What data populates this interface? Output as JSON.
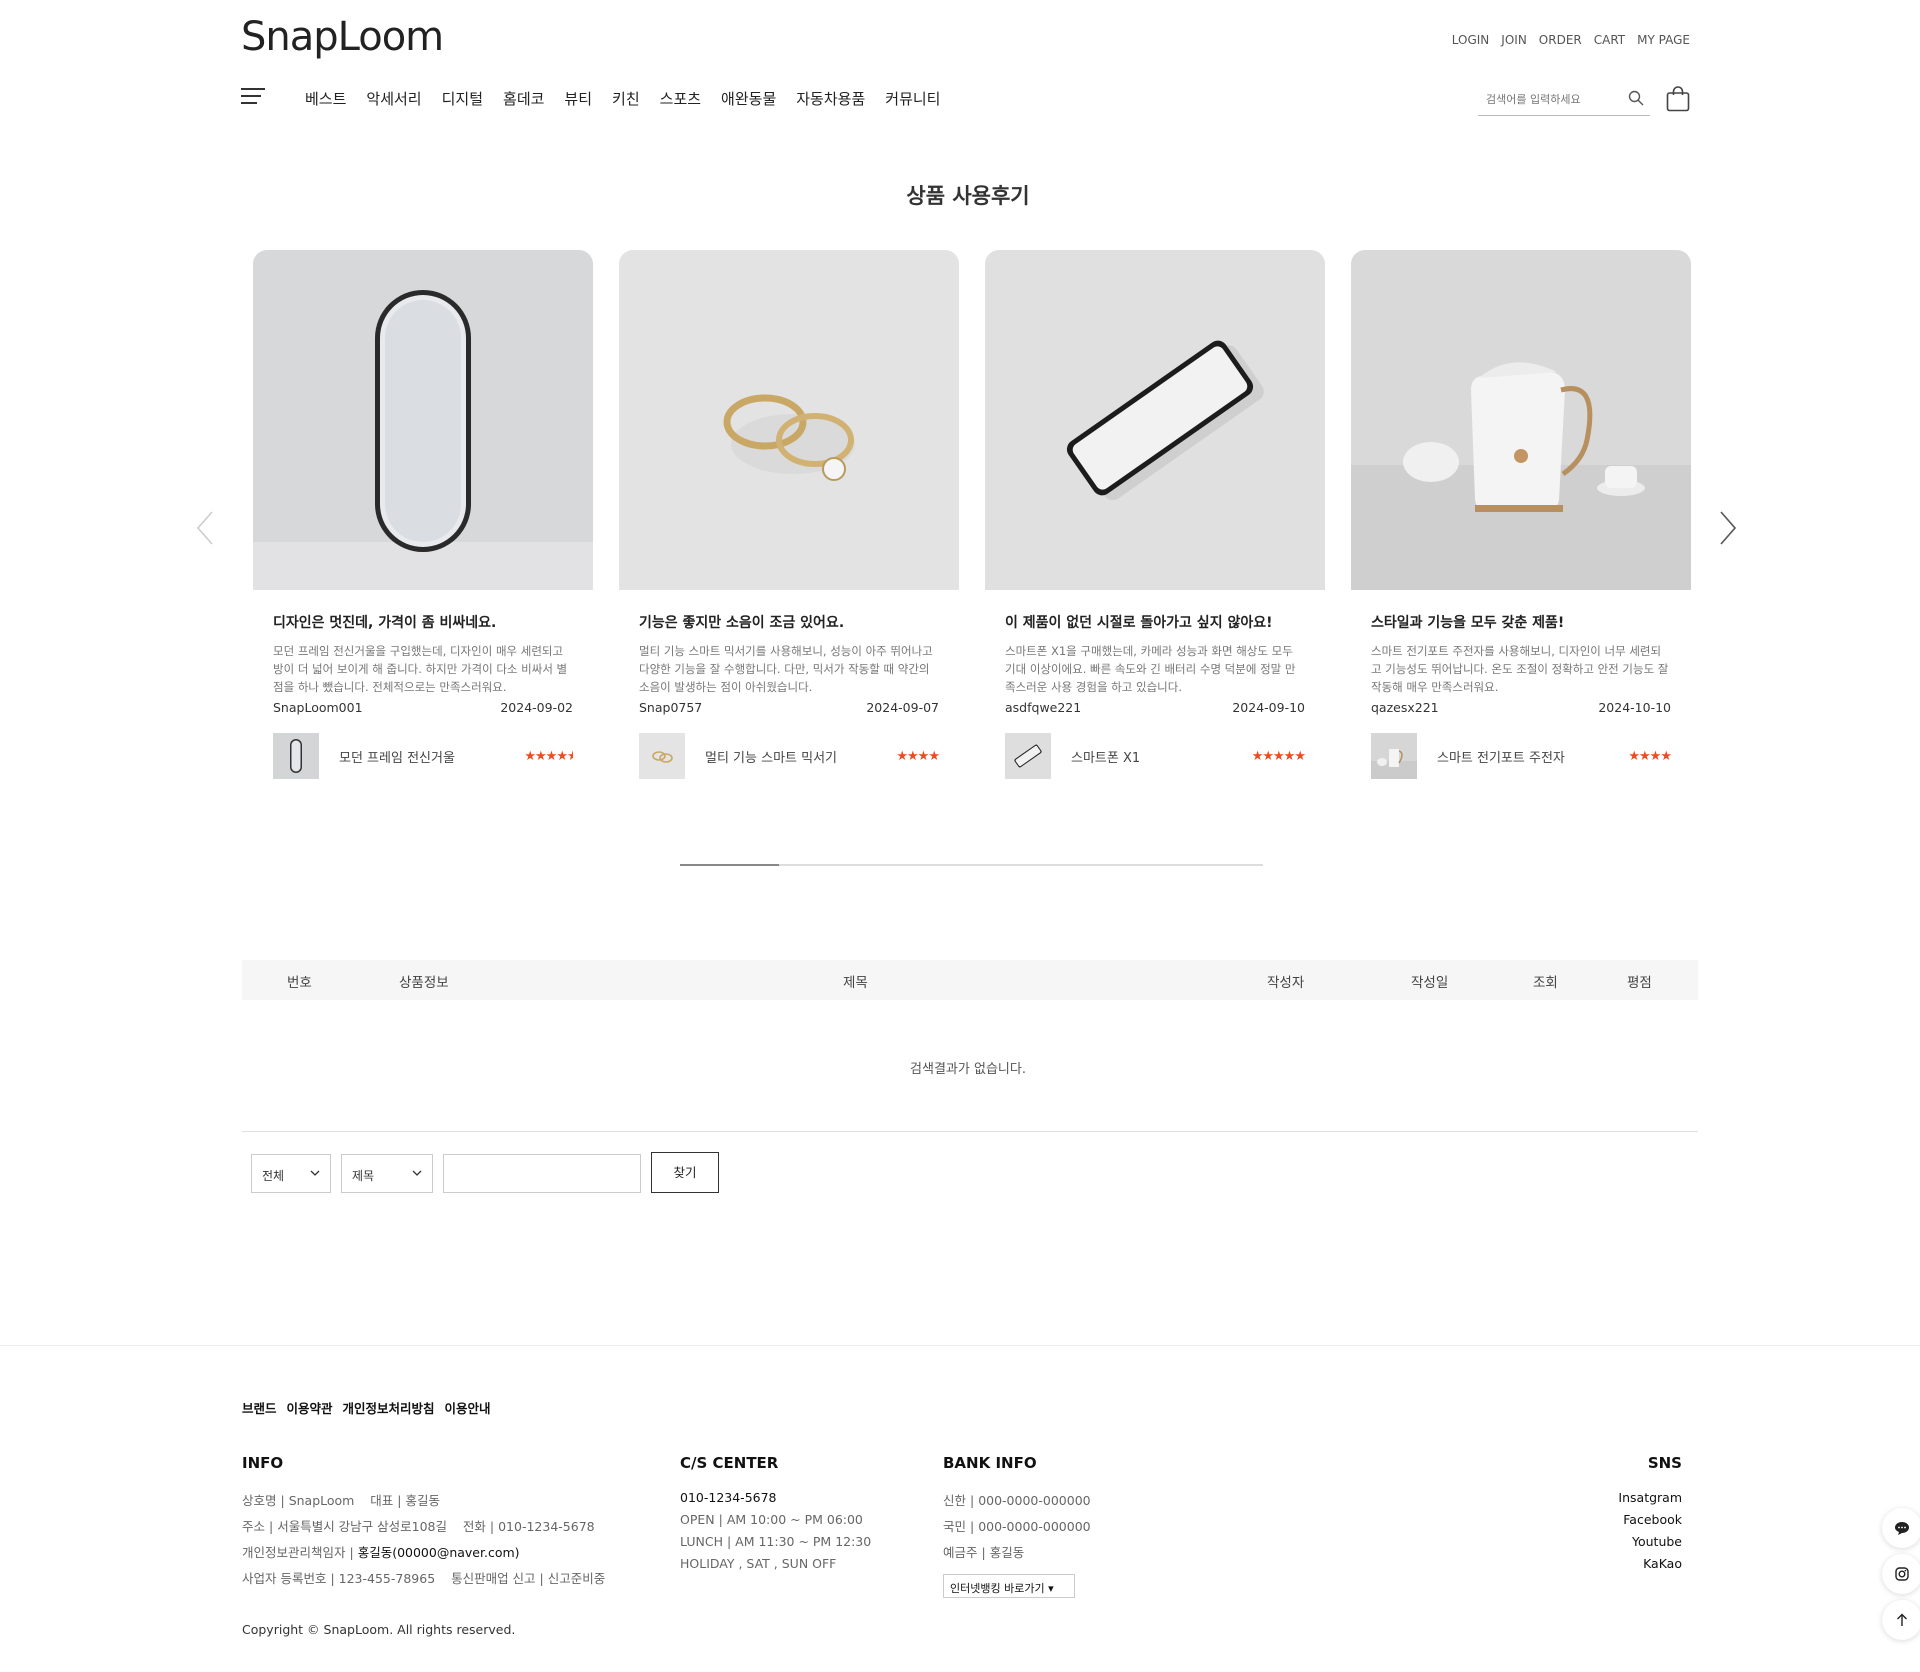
{
  "header": {
    "logo": "SnapLoom",
    "top_links": [
      "LOGIN",
      "JOIN",
      "ORDER",
      "CART",
      "MY PAGE"
    ],
    "nav": [
      "베스트",
      "악세서리",
      "디지털",
      "홈데코",
      "뷰티",
      "키친",
      "스포츠",
      "애완동물",
      "자동차용품",
      "커뮤니티"
    ],
    "search_placeholder": "검색어를 입력하세요"
  },
  "title": "상품 사용후기",
  "reviews": [
    {
      "title": "디자인은 멋진데, 가격이 좀 비싸네요.",
      "text": "모던 프레임 전신거울을 구입했는데, 디자인이 매우 세련되고 방이 더 넓어 보이게 해 줍니다. 하지만 가격이 다소 비싸서 별점을 하나 뺐습니다. 전체적으로는 만족스러워요.",
      "author": "SnapLoom001",
      "date": "2024-09-02",
      "product": "모던 프레임 전신거울",
      "rating": 4.5,
      "stars": "★★★★"
    },
    {
      "title": "기능은 좋지만 소음이 조금 있어요.",
      "text": "멀티 기능 스마트 믹서기를 사용해보니, 성능이 아주 뛰어나고 다양한 기능을 잘 수행합니다. 다만, 믹서가 작동할 때 약간의 소음이 발생하는 점이 아쉬웠습니다.",
      "author": "Snap0757",
      "date": "2024-09-07",
      "product": "멀티 기능 스마트 믹서기",
      "rating": 4,
      "stars": "★★★★"
    },
    {
      "title": "이 제품이 없던 시절로 돌아가고 싶지 않아요!",
      "text": "스마트폰 X1을 구매했는데, 카메라 성능과 화면 해상도 모두 기대 이상이에요. 빠른 속도와 긴 배터리 수명 덕분에 정말 만족스러운 사용 경험을 하고 있습니다.",
      "author": "asdfqwe221",
      "date": "2024-09-10",
      "product": "스마트폰 X1",
      "rating": 5,
      "stars": "★★★★★"
    },
    {
      "title": "스타일과 기능을 모두 갖춘 제품!",
      "text": "스마트 전기포트 주전자를 사용해보니, 디자인이 너무 세련되고 기능성도 뛰어납니다. 온도 조절이 정확하고 안전 기능도 잘 작동해 매우 만족스러워요.",
      "author": "qazesx221",
      "date": "2024-10-10",
      "product": "스마트 전기포트 주전자",
      "rating": 4,
      "stars": "★★★★"
    }
  ],
  "carousel_progress": 0.17,
  "table": {
    "headers": [
      "번호",
      "상품정보",
      "제목",
      "작성자",
      "작성일",
      "조회",
      "평점"
    ],
    "empty": "검색결과가 없습니다."
  },
  "search_form": {
    "scope": "전체",
    "field": "제목",
    "button": "찾기"
  },
  "footer": {
    "links": [
      "브랜드",
      "이용약관",
      "개인정보처리방침",
      "이용안내"
    ],
    "info": {
      "heading": "INFO",
      "l1_label_a": "상호명",
      "l1_val_a": "SnapLoom",
      "l1_label_b": "대표",
      "l1_val_b": "홍길동",
      "l2_label_a": "주소",
      "l2_val_a": "서울특별시 강남구 삼성로108길",
      "l2_label_b": "전화",
      "l2_val_b": "010-1234-5678",
      "l3_label": "개인정보관리책임자",
      "l3_val": "홍길동(00000@naver.com)",
      "l4_label_a": "사업자 등록번호",
      "l4_val_a": "123-455-78965",
      "l4_label_b": "통신판매업 신고",
      "l4_val_b": "신고준비중"
    },
    "cs": {
      "heading": "C/S CENTER",
      "phone": "010-1234-5678",
      "open": "OPEN",
      "open_time": "AM 10:00 ~ PM 06:00",
      "lunch": "LUNCH",
      "lunch_time": "AM 11:30 ~ PM 12:30",
      "holiday": "HOLIDAY , SAT , SUN OFF"
    },
    "bank": {
      "heading": "BANK INFO",
      "b1": "신한",
      "b1_no": "000-0000-000000",
      "b2": "국민",
      "b2_no": "000-0000-000000",
      "holder_label": "예금주",
      "holder": "홍길동",
      "select": "인터넷뱅킹 바로가기"
    },
    "sns": {
      "heading": "SNS",
      "items": [
        "Insatgram",
        "Facebook",
        "Youtube",
        "KaKao"
      ]
    },
    "copyright": "Copyright © SnapLoom. All rights reserved."
  },
  "colors": {
    "star": "#f04b1f",
    "text": "#333333"
  }
}
